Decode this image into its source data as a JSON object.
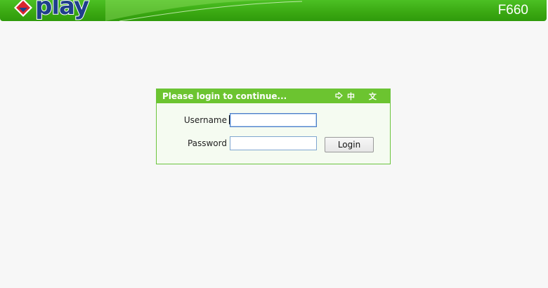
{
  "header": {
    "brand": "play",
    "model": "F660"
  },
  "login": {
    "title": "Please login to continue...",
    "language_toggle": "中 文",
    "username_label": "Username",
    "username_value": "",
    "password_label": "Password",
    "password_value": "",
    "login_button": "Login"
  },
  "colors": {
    "header_green": "#3aa812",
    "panel_header_green": "#6cc430",
    "panel_border": "#6cc43e",
    "brand_blue": "#1f3f8c",
    "logo_red": "#d9262e"
  },
  "icons": {
    "logo": "play-logo-icon",
    "language_arrow": "arrow-right-icon"
  }
}
